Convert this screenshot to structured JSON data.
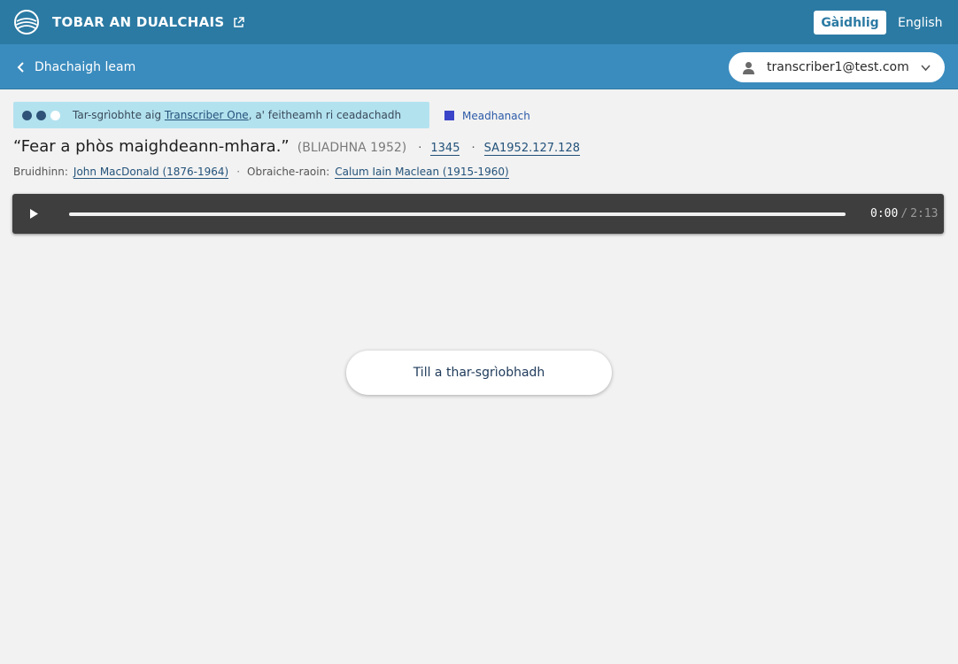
{
  "header": {
    "site_name": "TOBAR AN DUALCHAIS",
    "lang_active": "Gàidhlig",
    "lang_other": "English"
  },
  "subheader": {
    "back_label": "Dhachaigh leam",
    "user_email": "transcriber1@test.com"
  },
  "status": {
    "level_filled": 2,
    "level_total": 3,
    "prefix": "Tar-sgrìobhte aig ",
    "transcriber": "Transcriber One",
    "suffix": ", a' feitheamh ri ceadachadh"
  },
  "difficulty": {
    "label": "Meadhanach",
    "color": "#3a44c9"
  },
  "track": {
    "title": "“Fear a phòs maighdeann-mhara.”",
    "year": "(BLIADHNA 1952)",
    "id": "1345",
    "ref": "SA1952.127.128"
  },
  "people": {
    "speaker_label": "Bruidhinn:",
    "speaker": "John MacDonald (1876-1964)",
    "fieldworker_label": "Obraiche-raoin:",
    "fieldworker": "Calum Iain Maclean (1915-1960)"
  },
  "player": {
    "current": "0:00",
    "separator": "/",
    "duration": "2:13",
    "progress": 1.0
  },
  "action": {
    "label": "Till a thar-sgrìobhadh"
  },
  "colors": {
    "topbar": "#2b7aa3",
    "subbar": "#3b8cbe",
    "status_bg": "#b3e2ef",
    "link": "#23527a"
  }
}
